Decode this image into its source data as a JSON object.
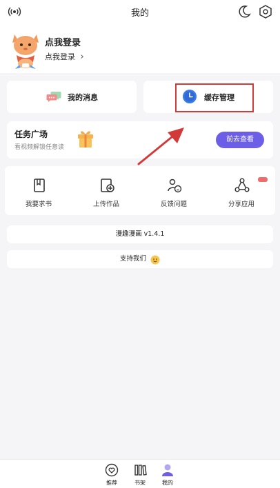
{
  "header": {
    "title": "我的",
    "left_icon": "broadcast-icon",
    "right_icons": [
      "moon-icon",
      "settings-hexagon-icon"
    ]
  },
  "profile": {
    "login_title": "点我登录",
    "login_subtitle": "点我登录",
    "chevron": "›"
  },
  "quick_cards": {
    "messages_label": "我的消息",
    "cache_label": "缓存管理"
  },
  "task": {
    "title": "任务广场",
    "subtitle": "看视频解锁任意读",
    "button_label": "前去查看"
  },
  "features": [
    {
      "label": "我要求书",
      "icon": "book-icon"
    },
    {
      "label": "上传作品",
      "icon": "upload-doc-icon"
    },
    {
      "label": "反馈问题",
      "icon": "user-feedback-icon"
    },
    {
      "label": "分享应用",
      "icon": "share-icon"
    }
  ],
  "version_text": "漫趣漫画 v1.4.1",
  "support_text": "支持我们",
  "bottom_nav": [
    {
      "label": "推荐",
      "icon": "heart-icon"
    },
    {
      "label": "书架",
      "icon": "bookshelf-icon"
    },
    {
      "label": "我的",
      "icon": "profile-icon"
    }
  ],
  "colors": {
    "accent": "#6d5ee8",
    "highlight_box": "#d23a3a",
    "annotation_arrow": "#d23a3a",
    "background": "#f5f5f7"
  }
}
